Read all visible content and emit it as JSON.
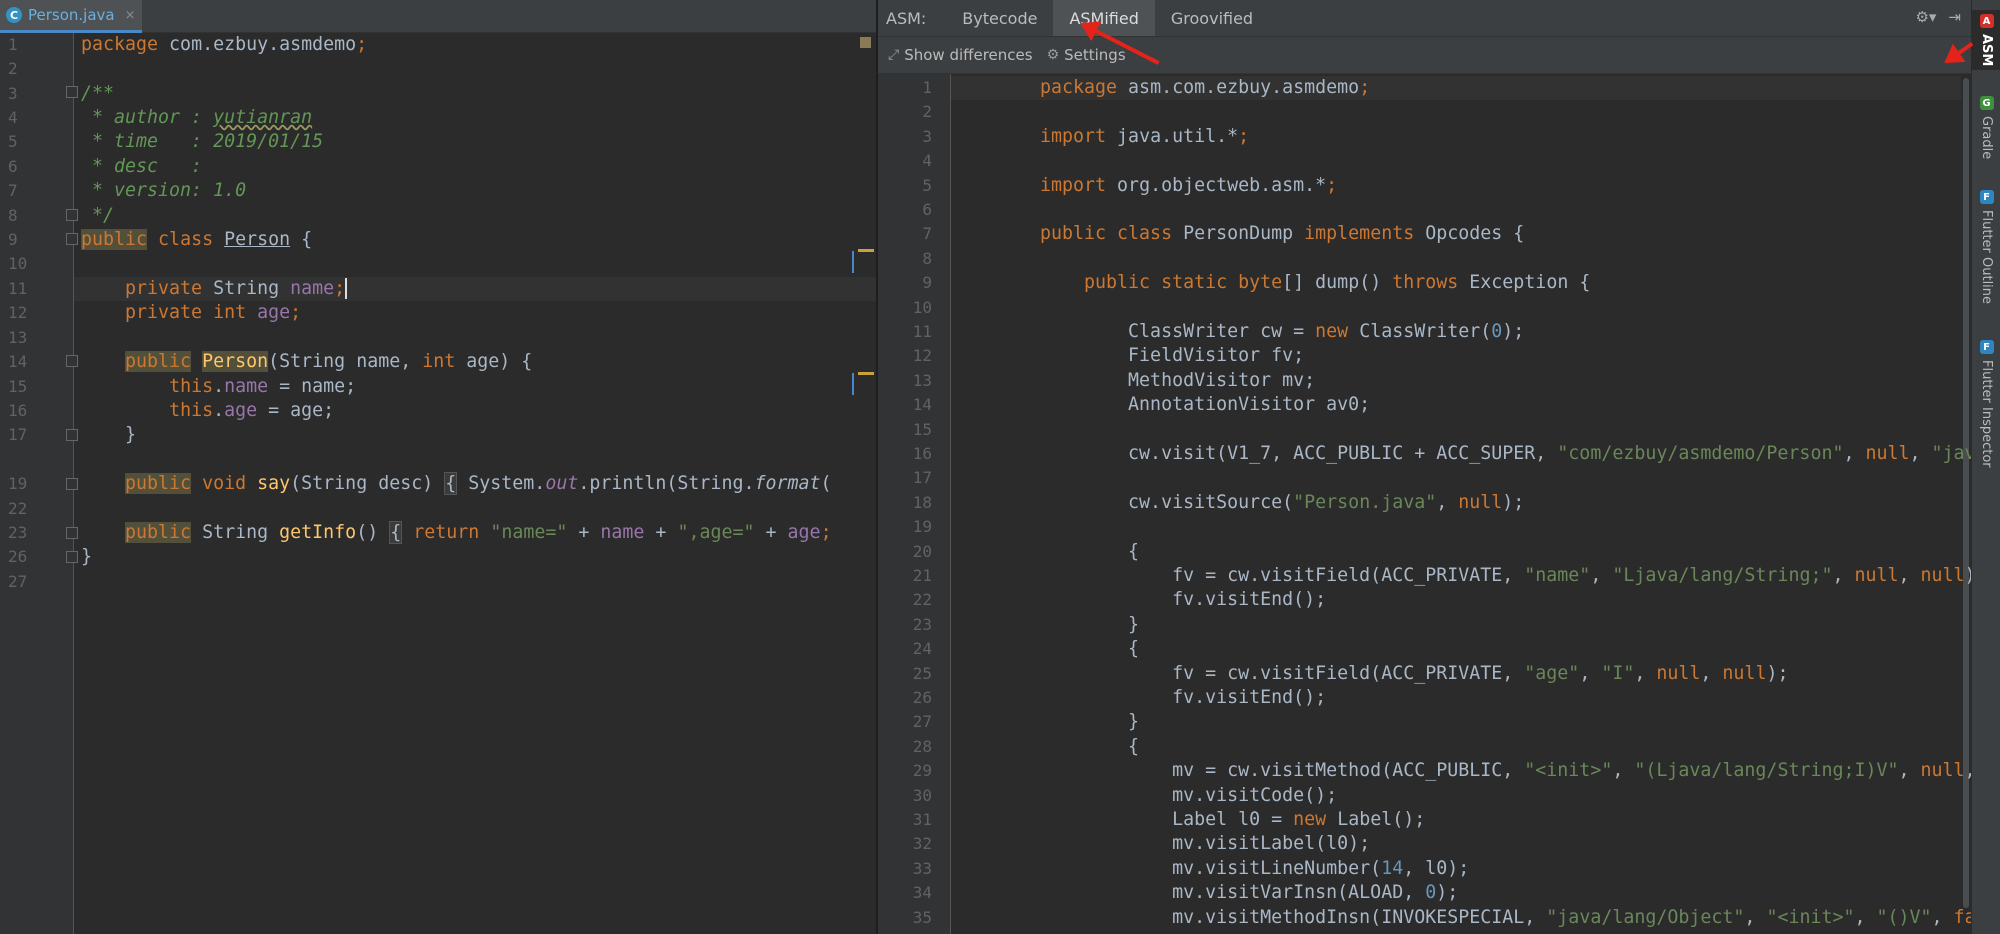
{
  "left_editor": {
    "file_tab": {
      "label": "Person.java",
      "close": "×",
      "icon": "java-file-icon"
    },
    "line_numbers": [
      "1",
      "2",
      "3",
      "4",
      "5",
      "6",
      "7",
      "8",
      "9",
      "10",
      "11",
      "12",
      "13",
      "14",
      "15",
      "16",
      "17",
      "19",
      "22",
      "23",
      "26",
      "27"
    ],
    "code": {
      "l1": [
        "package",
        " com.ezbuy.asmdemo",
        ";"
      ],
      "l3": "/**",
      "l4": [
        " * author : ",
        "yutianran"
      ],
      "l5": [
        " * time   : ",
        "2019/01/15"
      ],
      "l6": " * desc   :",
      "l7": " * version: 1.0",
      "l8": " */",
      "l9": [
        "public",
        " class ",
        "Person",
        " {"
      ],
      "l11": [
        "    private ",
        "String",
        " name",
        ";"
      ],
      "l12": [
        "    private ",
        "int",
        " age",
        ";"
      ],
      "l14": [
        "    ",
        "public",
        " ",
        "Person",
        "(String name, ",
        "int",
        " age) {"
      ],
      "l15": [
        "        ",
        "this",
        ".",
        "name",
        " = name;"
      ],
      "l16": [
        "        ",
        "this",
        ".",
        "age",
        " = age;"
      ],
      "l17": "    }",
      "l19": [
        "    ",
        "public",
        " void ",
        "say",
        "(String desc) ",
        "{",
        " System.",
        "out",
        ".println(String.",
        "format",
        "("
      ],
      "l23": [
        "    ",
        "public",
        " String ",
        "getInfo",
        "() ",
        "{",
        " ",
        "return",
        " ",
        "\"name=\"",
        " + ",
        "name",
        " + ",
        "\",age=\"",
        " + ",
        "age",
        ";"
      ],
      "l26": "}"
    }
  },
  "asm_panel": {
    "label": "ASM:",
    "tabs": [
      {
        "label": "Bytecode"
      },
      {
        "label": "ASMified",
        "active": true
      },
      {
        "label": "Groovified"
      }
    ],
    "tool_icons": [
      "gear-icon",
      "pin-icon"
    ],
    "toolbar": {
      "show_differences": "Show differences",
      "settings": "Settings"
    },
    "line_numbers": [
      "1",
      "2",
      "3",
      "4",
      "5",
      "6",
      "7",
      "8",
      "9",
      "10",
      "11",
      "12",
      "13",
      "14",
      "15",
      "16",
      "17",
      "18",
      "19",
      "20",
      "21",
      "22",
      "23",
      "24",
      "25",
      "26",
      "27",
      "28",
      "29",
      "30",
      "31",
      "32",
      "33",
      "34",
      "35"
    ],
    "code": {
      "l1": [
        "package",
        " asm.com.ezbuy.asmdemo",
        ";"
      ],
      "l3": [
        "import",
        " java.util.*",
        ";"
      ],
      "l5": [
        "import",
        " org.objectweb.asm.*",
        ";"
      ],
      "l7": [
        "public class",
        " PersonDump ",
        "implements",
        " Opcodes {"
      ],
      "l9": [
        "    ",
        "public static byte",
        "[] dump() ",
        "throws",
        " Exception {"
      ],
      "l11": [
        "        ClassWriter cw = ",
        "new",
        " ClassWriter(",
        "0",
        ");"
      ],
      "l12": "        FieldVisitor fv;",
      "l13": "        MethodVisitor mv;",
      "l14": "        AnnotationVisitor av0;",
      "l16": [
        "        cw.visit(V1_7, ACC_PUBLIC + ACC_SUPER, ",
        "\"com/ezbuy/asmdemo/Person\"",
        ", ",
        "null",
        ", ",
        "\"java/l"
      ],
      "l18": [
        "        cw.visitSource(",
        "\"Person.java\"",
        ", ",
        "null",
        ");"
      ],
      "l20": "        {",
      "l21": [
        "            fv = cw.visitField(ACC_PRIVATE, ",
        "\"name\"",
        ", ",
        "\"Ljava/lang/String;\"",
        ", ",
        "null",
        ", ",
        "null",
        ");"
      ],
      "l22": "            fv.visitEnd();",
      "l23": "        }",
      "l24": "        {",
      "l25": [
        "            fv = cw.visitField(ACC_PRIVATE, ",
        "\"age\"",
        ", ",
        "\"I\"",
        ", ",
        "null",
        ", ",
        "null",
        ");"
      ],
      "l26": "            fv.visitEnd();",
      "l27": "        }",
      "l28": "        {",
      "l29": [
        "            mv = cw.visitMethod(ACC_PUBLIC, ",
        "\"<init>\"",
        ", ",
        "\"(Ljava/lang/String;I)V\"",
        ", ",
        "null",
        ", ",
        "nu"
      ],
      "l30": "            mv.visitCode();",
      "l31": [
        "            Label l0 = ",
        "new",
        " Label();"
      ],
      "l32": "            mv.visitLabel(l0);",
      "l33": [
        "            mv.visitLineNumber(",
        "14",
        ", l0);"
      ],
      "l34": [
        "            mv.visitVarInsn(ALOAD, ",
        "0",
        ");"
      ],
      "l35": [
        "            mv.visitMethodInsn(INVOKESPECIAL, ",
        "\"java/lang/Object\"",
        ", ",
        "\"<init>\"",
        ", ",
        "\"()V\"",
        ", ",
        "false"
      ]
    }
  },
  "side_strip": [
    {
      "label": "ASM",
      "icon": "asm-icon",
      "active": true
    },
    {
      "label": "Gradle",
      "icon": "gradle-icon"
    },
    {
      "label": "Flutter Outline",
      "icon": "flutter-icon"
    },
    {
      "label": "Flutter Inspector",
      "icon": "flutter-icon"
    }
  ],
  "colors": {
    "keyword": "#cc7832",
    "string": "#6a8759",
    "comment": "#629755",
    "field": "#9876aa",
    "number": "#6897bb",
    "function": "#ffc66d",
    "annotation_arrow": "#e5231b"
  }
}
